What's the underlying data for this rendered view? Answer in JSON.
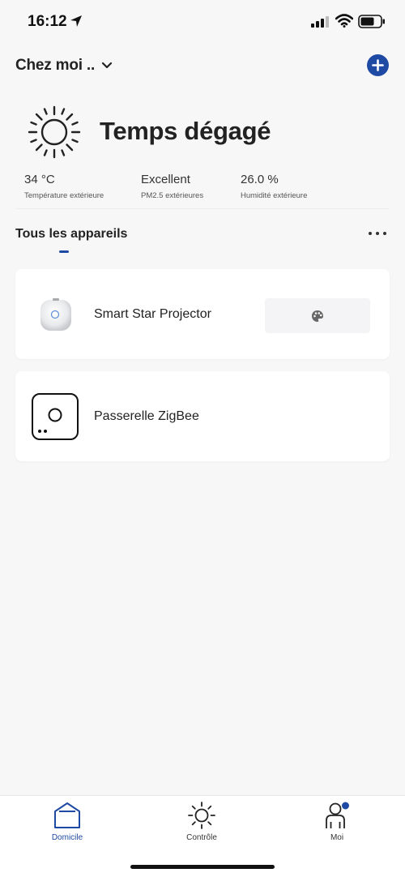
{
  "status_bar": {
    "time": "16:12"
  },
  "header": {
    "home_name": "Chez moi ..",
    "add_label": ""
  },
  "weather": {
    "condition": "Temps dégagé",
    "stats": [
      {
        "value": "34 °C",
        "label": "Température extérieure"
      },
      {
        "value": "Excellent",
        "label": "PM2.5 extérieures"
      },
      {
        "value": "26.0 %",
        "label": "Humidité extérieure"
      }
    ]
  },
  "section": {
    "tab_label": "Tous les appareils"
  },
  "devices": [
    {
      "name": "Smart Star Projector",
      "icon": "projector-icon",
      "action_icon": "palette-icon"
    },
    {
      "name": "Passerelle ZigBee",
      "icon": "gateway-icon"
    }
  ],
  "nav": {
    "items": [
      {
        "label": "Domicile",
        "icon": "home-icon",
        "active": true
      },
      {
        "label": "Contrôle",
        "icon": "sun-icon",
        "active": false
      },
      {
        "label": "Moi",
        "icon": "person-icon",
        "active": false
      }
    ]
  },
  "colors": {
    "accent": "#1f4aa3",
    "background": "#f7f7f7",
    "card": "#ffffff"
  }
}
